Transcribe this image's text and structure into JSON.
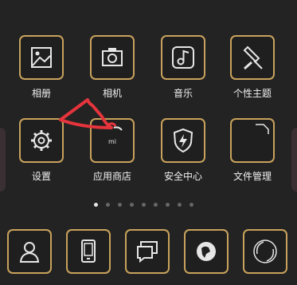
{
  "apps_row1": [
    {
      "label": "相册",
      "icon": "photo-icon"
    },
    {
      "label": "相机",
      "icon": "camera-icon"
    },
    {
      "label": "音乐",
      "icon": "music-note-icon"
    },
    {
      "label": "个性主题",
      "icon": "theme-brush-icon"
    }
  ],
  "apps_row2": [
    {
      "label": "设置",
      "icon": "gear-icon"
    },
    {
      "label": "应用商店",
      "icon": "app-store-bag-icon",
      "badge": "mi"
    },
    {
      "label": "安全中心",
      "icon": "shield-bolt-icon"
    },
    {
      "label": "文件管理",
      "icon": "folder-icon"
    }
  ],
  "page_indicator": {
    "count": 9,
    "active_index": 0
  },
  "dock": [
    {
      "icon": "contacts-person-icon"
    },
    {
      "icon": "phone-icon"
    },
    {
      "icon": "messages-icon"
    },
    {
      "icon": "browser-globe-icon"
    },
    {
      "icon": "camera-shutter-icon"
    }
  ],
  "colors": {
    "accent_border": "#c8a25c",
    "background": "#232323",
    "annotation": "#e5343c"
  }
}
